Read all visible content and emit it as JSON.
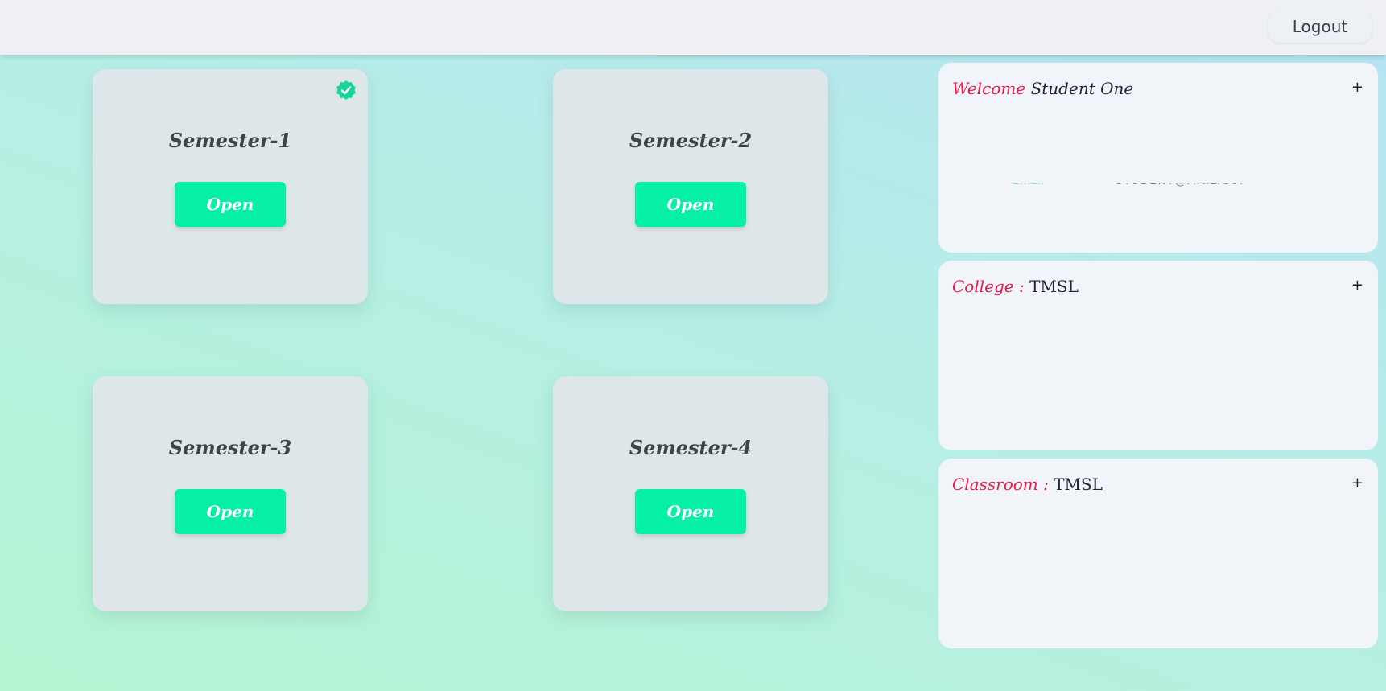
{
  "header": {
    "logout_label": "Logout"
  },
  "semesters": [
    {
      "title": "Semester-1",
      "button_label": "Open",
      "completed": true
    },
    {
      "title": "Semester-2",
      "button_label": "Open",
      "completed": false
    },
    {
      "title": "Semester-3",
      "button_label": "Open",
      "completed": false
    },
    {
      "title": "Semester-4",
      "button_label": "Open",
      "completed": false
    }
  ],
  "profile": {
    "welcome_label": "Welcome",
    "student_name": "Student One",
    "college_label": "College :",
    "college_value": "TMSL",
    "classroom_label": "Classroom :",
    "classroom_value": "TMSL",
    "expand_symbol": "+"
  },
  "colors": {
    "accent_button": "#05f0a4",
    "label_red": "#e8184a",
    "check_badge": "#18d49a"
  },
  "icons": {
    "completed": "check-badge-icon",
    "expand": "plus-icon"
  }
}
